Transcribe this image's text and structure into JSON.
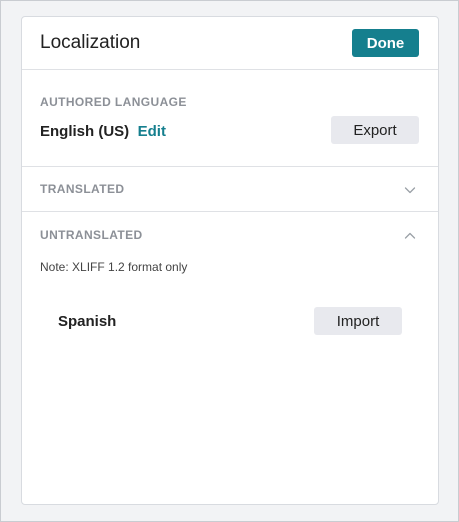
{
  "panel": {
    "title": "Localization",
    "done_label": "Done"
  },
  "authored": {
    "section_label": "AUTHORED LANGUAGE",
    "language": "English (US)",
    "edit_label": "Edit",
    "export_label": "Export"
  },
  "translated": {
    "section_label": "TRANSLATED",
    "expanded": false
  },
  "untranslated": {
    "section_label": "UNTRANSLATED",
    "expanded": true,
    "note": "Note: XLIFF 1.2 format only",
    "languages": [
      {
        "name": "Spanish",
        "action_label": "Import"
      }
    ]
  },
  "colors": {
    "accent": "#157f8e",
    "button_gray": "#e8e9ee",
    "label_gray": "#8c9097"
  }
}
